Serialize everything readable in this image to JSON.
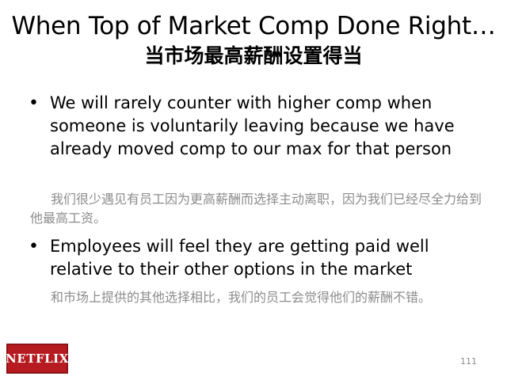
{
  "slide": {
    "title": "When Top of Market Comp Done Right…",
    "subtitle": "当市场最高薪酬设置得当",
    "bullets": [
      {
        "marker": "•",
        "text": "We will rarely counter with higher comp when someone is voluntarily leaving because we have already moved comp to our max for that person",
        "translation": "我们很少遇见有员工因为更高薪酬而选择主动离职，因为我们已经尽全力给到他最高工资。"
      },
      {
        "marker": "•",
        "text": "Employees will feel they are getting paid well relative to their other options in the market",
        "translation": "和市场上提供的其他选择相比，我们的员工会觉得他们的薪酬不错。"
      }
    ],
    "logo_text": "NETFLIX",
    "page_number": "111",
    "colors": {
      "text": "#000000",
      "translation": "#8c8c8c",
      "logo_background": "#b51b20"
    }
  }
}
